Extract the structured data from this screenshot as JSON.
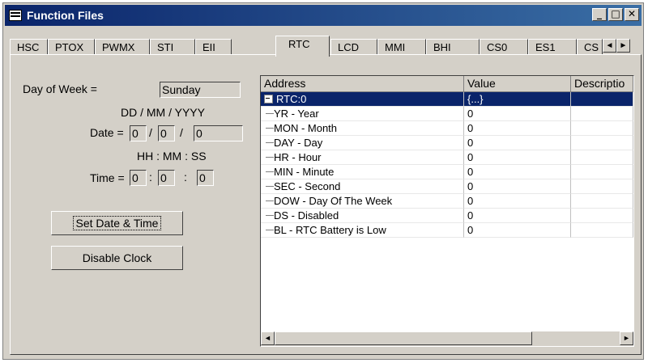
{
  "window": {
    "title": "Function Files"
  },
  "title_buttons": {
    "minimize": "_",
    "maximize": "□",
    "close": "✕"
  },
  "tabs": [
    {
      "label": "HSC"
    },
    {
      "label": "PTOX"
    },
    {
      "label": "PWMX"
    },
    {
      "label": "STI"
    },
    {
      "label": "EII"
    },
    {
      "label": "RTC"
    },
    {
      "label": "LCD"
    },
    {
      "label": "MMI"
    },
    {
      "label": "BHI"
    },
    {
      "label": "CS0"
    },
    {
      "label": "ES1"
    },
    {
      "label": "CS"
    }
  ],
  "active_tab": "RTC",
  "tab_scroll": {
    "left": "◄",
    "right": "►"
  },
  "rtc": {
    "day_of_week_label": "Day of Week =",
    "day_of_week_value": "Sunday",
    "date_format": "DD / MM / YYYY",
    "date_label": "Date =",
    "date_dd": "0",
    "date_mm": "0",
    "date_yyyy": "0",
    "date_sep": "/",
    "time_format": "HH : MM : SS",
    "time_label": "Time =",
    "time_hh": "0",
    "time_mm": "0",
    "time_ss": "0",
    "time_sep": ":",
    "set_button": "Set Date & Time",
    "disable_button": "Disable Clock"
  },
  "table": {
    "columns": [
      "Address",
      "Value",
      "Descriptio"
    ],
    "root": {
      "address": "RTC:0",
      "value": "{...}"
    },
    "rows": [
      {
        "address": "YR - Year",
        "value": "0"
      },
      {
        "address": "MON - Month",
        "value": "0"
      },
      {
        "address": "DAY - Day",
        "value": "0"
      },
      {
        "address": "HR - Hour",
        "value": "0"
      },
      {
        "address": "MIN - Minute",
        "value": "0"
      },
      {
        "address": "SEC - Second",
        "value": "0"
      },
      {
        "address": "DOW - Day Of The Week",
        "value": "0"
      },
      {
        "address": "DS - Disabled",
        "value": "0"
      },
      {
        "address": "BL - RTC Battery is Low",
        "value": "0"
      }
    ]
  },
  "scrollbar": {
    "left": "◄",
    "right": "►"
  }
}
